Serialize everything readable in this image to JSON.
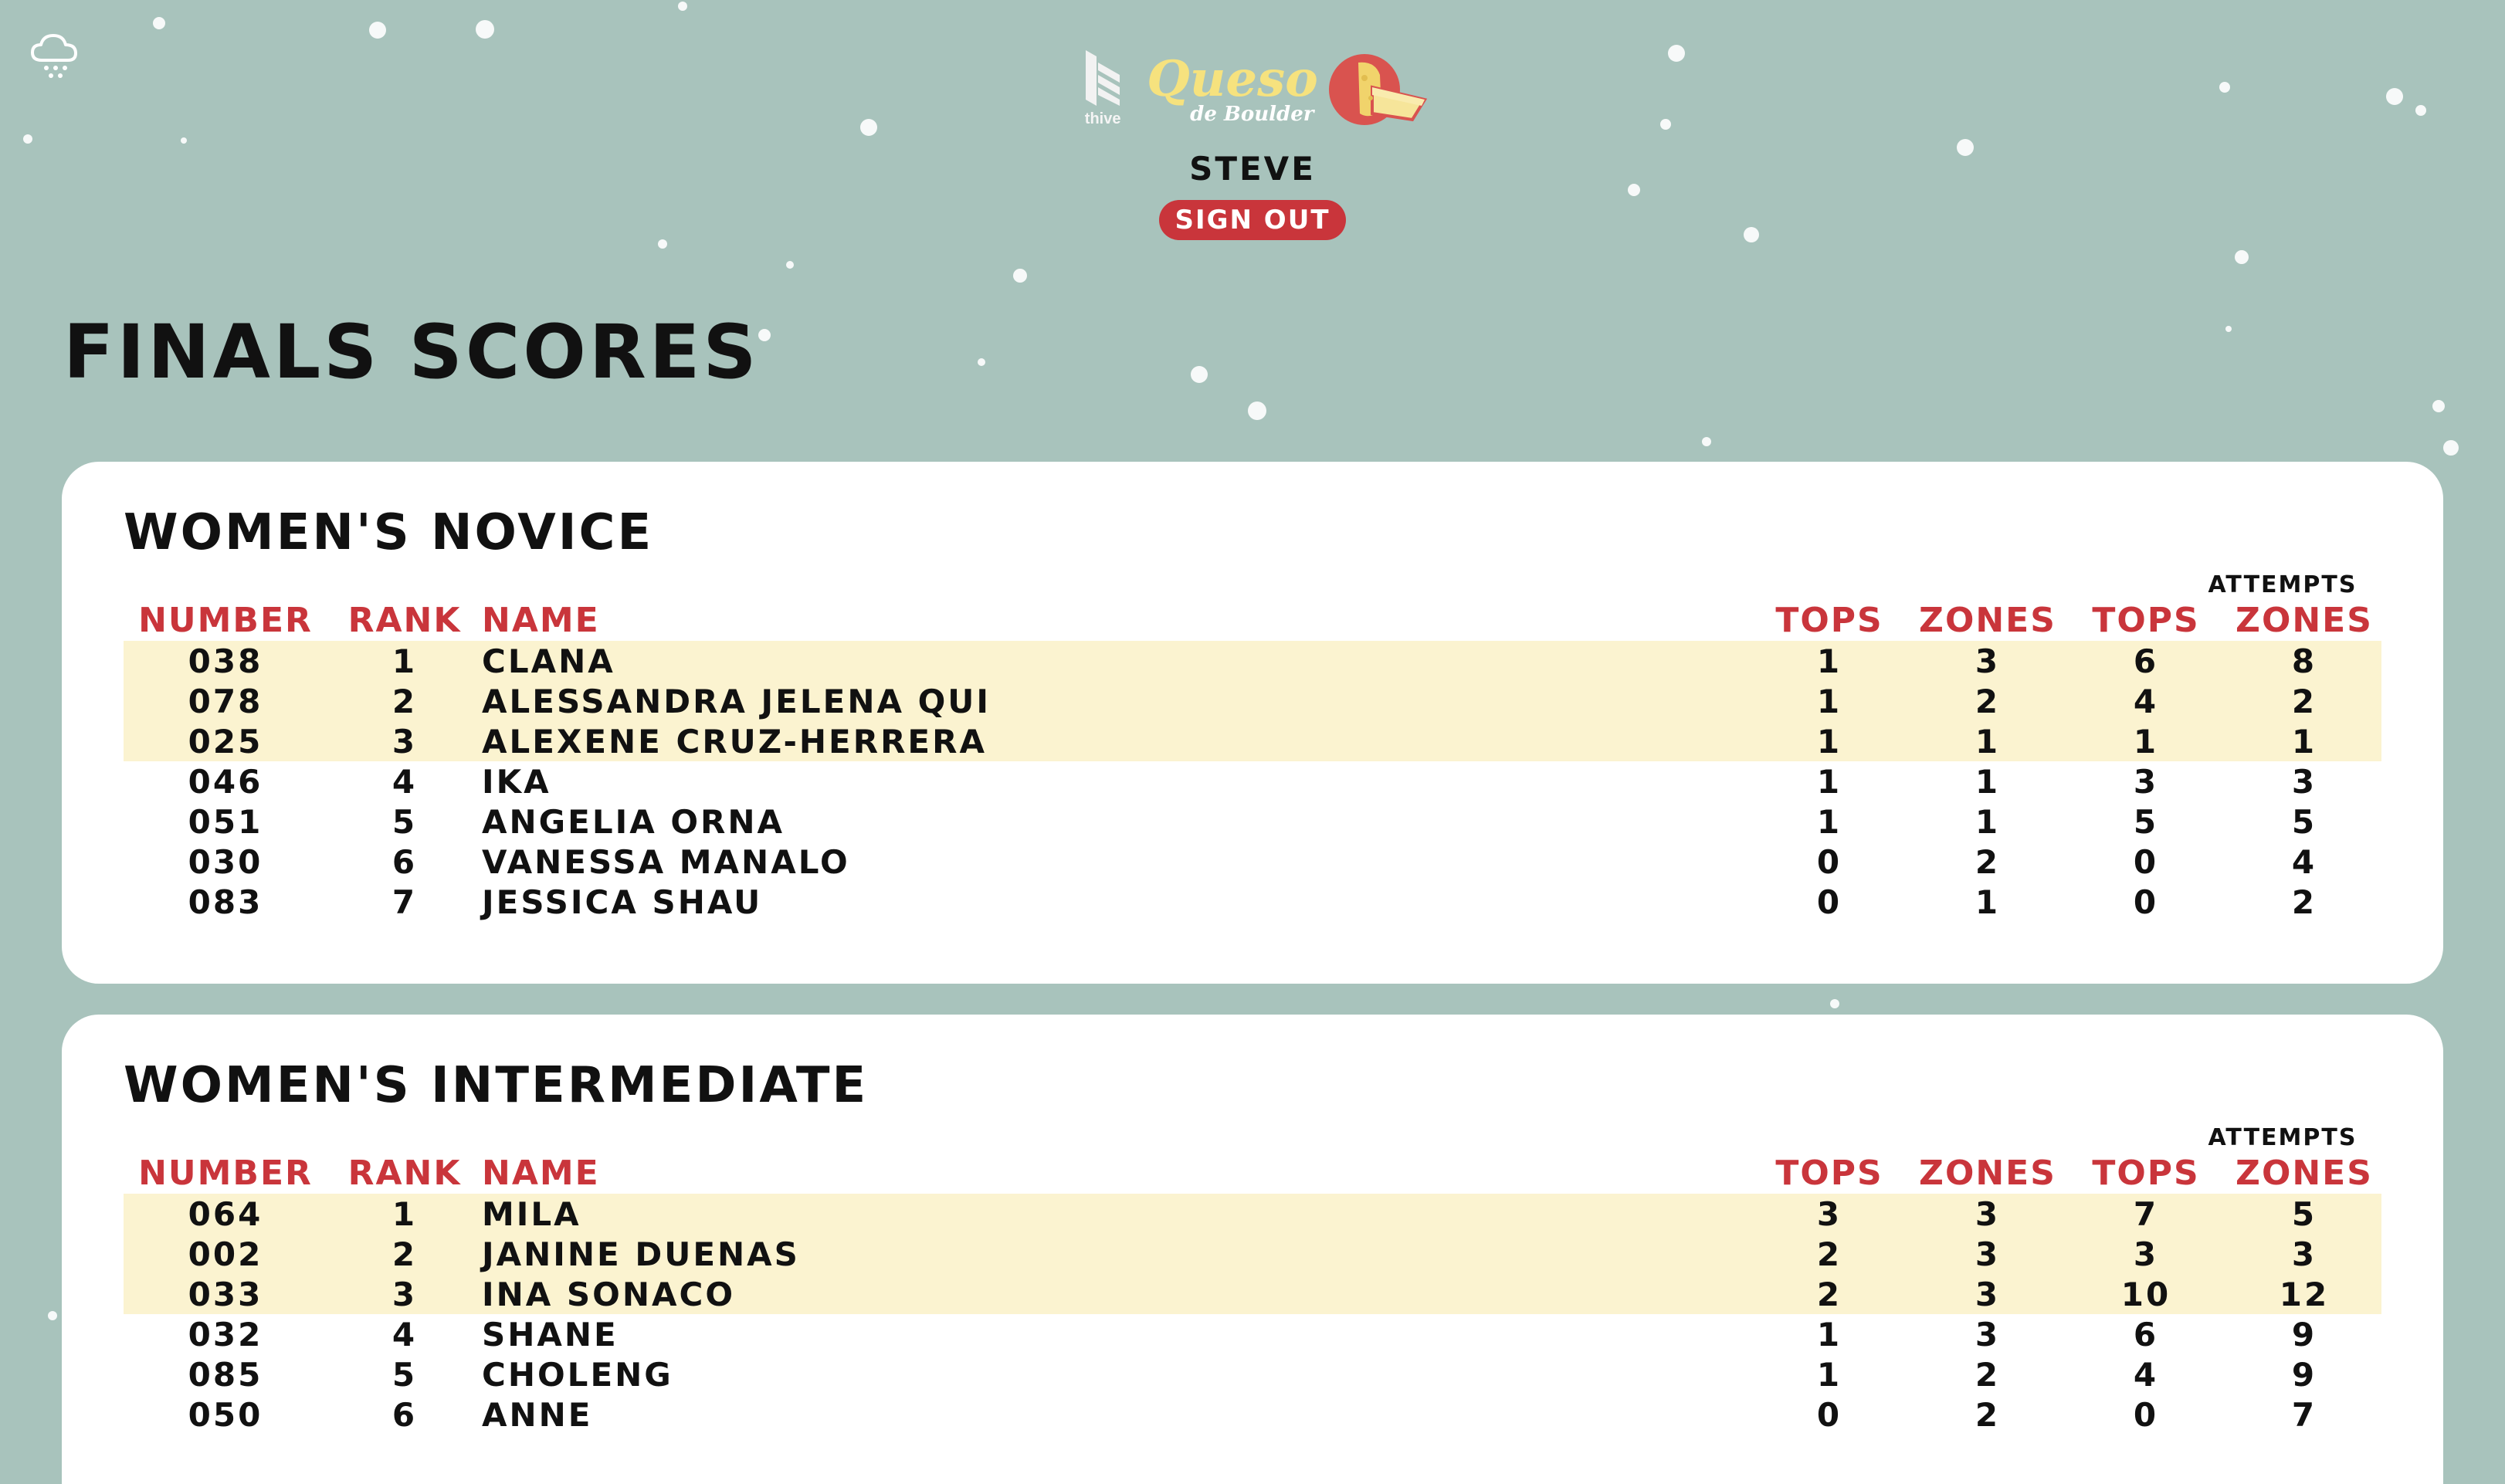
{
  "header": {
    "logo_thive": "thive",
    "logo_queso": "Queso",
    "logo_queso_sub": "de Boulder",
    "user": "STEVE",
    "sign_out": "SIGN OUT"
  },
  "icons": {
    "weather": "snow-cloud-icon",
    "thive_logo": "thive-logo-icon",
    "cheese_logo": "cheese-wheel-icon"
  },
  "colors": {
    "background": "#a8c3bc",
    "accent_red": "#c9353b",
    "podium_highlight": "#fbf3d0",
    "queso_yellow": "#f6e27e"
  },
  "page": {
    "title": "FINALS SCORES"
  },
  "columns": {
    "number": "NUMBER",
    "rank": "RANK",
    "name": "NAME",
    "tops": "TOPS",
    "zones": "ZONES",
    "attempts": "ATTEMPTS",
    "att_tops": "TOPS",
    "att_zones": "ZONES"
  },
  "categories": [
    {
      "title": "WOMEN'S NOVICE",
      "rows": [
        {
          "number": "038",
          "rank": "1",
          "name": "CLANA",
          "tops": "1",
          "zones": "3",
          "att_tops": "6",
          "att_zones": "8"
        },
        {
          "number": "078",
          "rank": "2",
          "name": "ALESSANDRA JELENA QUI",
          "tops": "1",
          "zones": "2",
          "att_tops": "4",
          "att_zones": "2"
        },
        {
          "number": "025",
          "rank": "3",
          "name": "ALEXENE CRUZ-HERRERA",
          "tops": "1",
          "zones": "1",
          "att_tops": "1",
          "att_zones": "1"
        },
        {
          "number": "046",
          "rank": "4",
          "name": "IKA",
          "tops": "1",
          "zones": "1",
          "att_tops": "3",
          "att_zones": "3"
        },
        {
          "number": "051",
          "rank": "5",
          "name": "ANGELIA ORNA",
          "tops": "1",
          "zones": "1",
          "att_tops": "5",
          "att_zones": "5"
        },
        {
          "number": "030",
          "rank": "6",
          "name": "VANESSA MANALO",
          "tops": "0",
          "zones": "2",
          "att_tops": "0",
          "att_zones": "4"
        },
        {
          "number": "083",
          "rank": "7",
          "name": "JESSICA SHAU",
          "tops": "0",
          "zones": "1",
          "att_tops": "0",
          "att_zones": "2"
        }
      ]
    },
    {
      "title": "WOMEN'S INTERMEDIATE",
      "rows": [
        {
          "number": "064",
          "rank": "1",
          "name": "MILA",
          "tops": "3",
          "zones": "3",
          "att_tops": "7",
          "att_zones": "5"
        },
        {
          "number": "002",
          "rank": "2",
          "name": "JANINE DUENAS",
          "tops": "2",
          "zones": "3",
          "att_tops": "3",
          "att_zones": "3"
        },
        {
          "number": "033",
          "rank": "3",
          "name": "INA SONACO",
          "tops": "2",
          "zones": "3",
          "att_tops": "10",
          "att_zones": "12"
        },
        {
          "number": "032",
          "rank": "4",
          "name": "SHANE",
          "tops": "1",
          "zones": "3",
          "att_tops": "6",
          "att_zones": "9"
        },
        {
          "number": "085",
          "rank": "5",
          "name": "CHOLENG",
          "tops": "1",
          "zones": "2",
          "att_tops": "4",
          "att_zones": "9"
        },
        {
          "number": "050",
          "rank": "6",
          "name": "ANNE",
          "tops": "0",
          "zones": "2",
          "att_tops": "0",
          "att_zones": "7"
        }
      ]
    }
  ]
}
